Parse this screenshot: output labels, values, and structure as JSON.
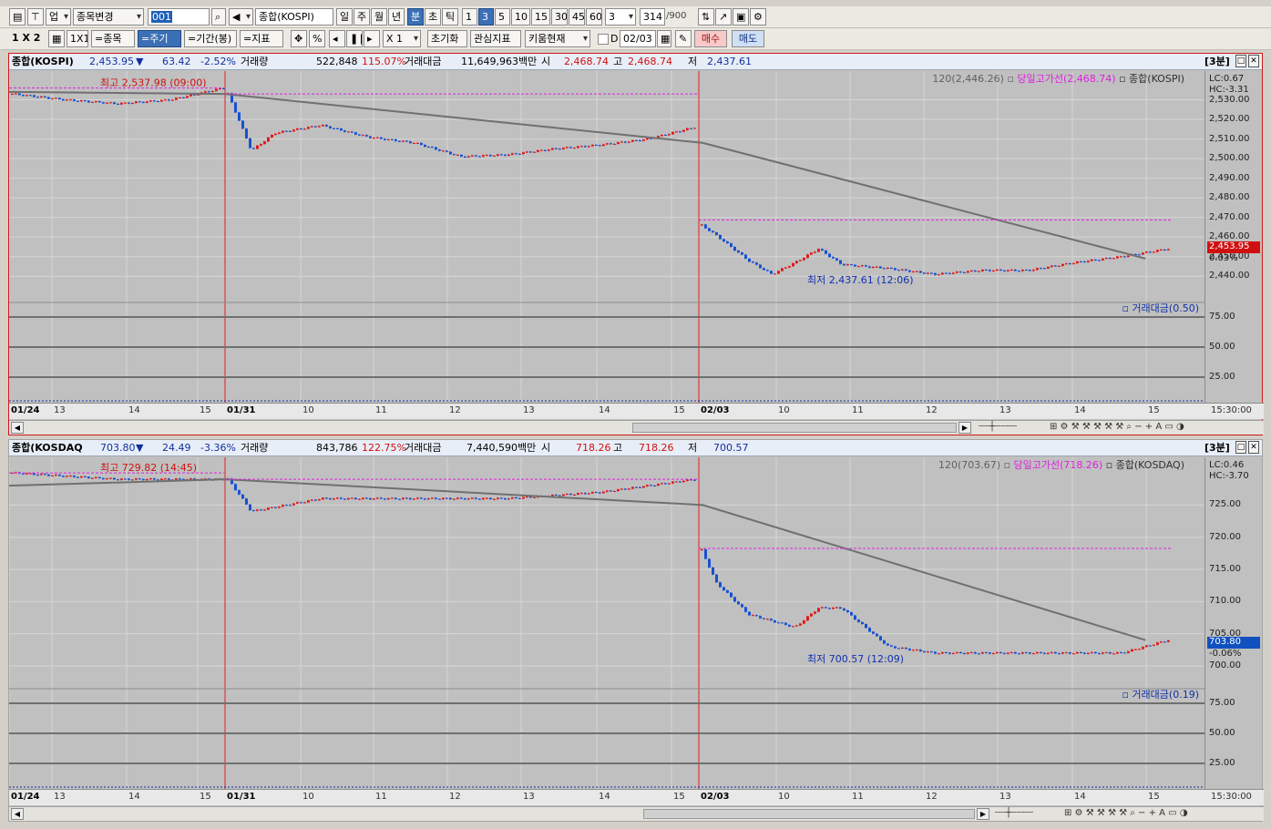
{
  "toolbar1": {
    "type_label": "업",
    "stock_change": "종목변경",
    "code": "001",
    "name": "종합(KOSPI)",
    "periods": [
      "일",
      "주",
      "월",
      "년",
      "분",
      "초",
      "틱"
    ],
    "minutes": [
      "1",
      "3",
      "5",
      "10",
      "15",
      "30",
      "45",
      "60"
    ],
    "count_select": "3",
    "count": "314",
    "count_total": "/900"
  },
  "toolbar2": {
    "layout_1x2": "1 X 2",
    "layout_1x1": "1X1",
    "btn_stock": "=종목",
    "btn_period": "=주기",
    "btn_range": "=기간(봉)",
    "btn_indicator": "=지표",
    "pct": "%",
    "zoom": "X 1",
    "reset": "초기화",
    "watch": "관심지표",
    "kiwoom": "키움현재",
    "date": "02/03",
    "buy": "매수",
    "sell": "매도"
  },
  "panel1": {
    "name": "종합(KOSPI)",
    "price": "2,453.95",
    "arrow": "▼",
    "change": "63.42",
    "rate": "-2.52%",
    "vol_label": "거래량",
    "vol": "522,848",
    "vol_rate": "115.07%",
    "amt_label": "거래대금",
    "amt": "11,649,963백만",
    "open_label": "시",
    "open": "2,468.74",
    "high_label": "고",
    "high": "2,468.74",
    "low_label": "저",
    "low": "2,437.61",
    "interval": "[3분]",
    "legend_ma": "120(2,446.26)",
    "legend_hl": "당일고가선(2,468.74)",
    "legend_name": "종합(KOSPI)",
    "lc": "LC:0.67",
    "hc": "HC:-3.31",
    "ann_high": "최고 2,537.98 (09:00)",
    "ann_low": "최저 2,437.61 (12:06)",
    "cur_tag": "2,453.95",
    "cur_pct": "0.03%",
    "y_ticks": [
      "2,530.00",
      "2,520.00",
      "2,510.00",
      "2,500.00",
      "2,490.00",
      "2,480.00",
      "2,470.00",
      "2,460.00",
      "2,450.00",
      "2,440.00"
    ],
    "sub_legend": "거래대금(0.50)",
    "sub_ticks": [
      "75.00",
      "50.00",
      "25.00"
    ],
    "time_end": "15:30:00"
  },
  "panel2": {
    "name": "종합(KOSDAQ",
    "price": "703.80",
    "arrow": "▼",
    "change": "24.49",
    "rate": "-3.36%",
    "vol_label": "거래량",
    "vol": "843,786",
    "vol_rate": "122.75%",
    "amt_label": "거래대금",
    "amt": "7,440,590백만",
    "open_label": "시",
    "open": "718.26",
    "high_label": "고",
    "high": "718.26",
    "low_label": "저",
    "low": "700.57",
    "interval": "[3분]",
    "legend_ma": "120(703.67)",
    "legend_hl": "당일고가선(718.26)",
    "legend_name": "종합(KOSDAQ)",
    "lc": "LC:0.46",
    "hc": "HC:-3.70",
    "ann_high": "최고 729.82 (14:45)",
    "ann_low": "최저 700.57 (12:09)",
    "cur_tag": "703.80",
    "cur_pct": "-0.06%",
    "y_ticks": [
      "725.00",
      "720.00",
      "715.00",
      "710.00",
      "705.00",
      "700.00"
    ],
    "sub_legend": "거래대금(0.19)",
    "sub_ticks": [
      "75.00",
      "50.00",
      "25.00"
    ],
    "time_end": "15:30:00"
  },
  "x_labels": [
    "01/24",
    "13",
    "14",
    "15",
    "01/31",
    "10",
    "11",
    "12",
    "13",
    "14",
    "15",
    "02/03",
    "10",
    "11",
    "12",
    "13",
    "14",
    "15"
  ],
  "chart_data": [
    {
      "type": "candlestick",
      "title": "종합(KOSPI)",
      "interval": "3분",
      "ylim": [
        2435,
        2540
      ],
      "sessions": [
        {
          "date": "01/24",
          "x": [
            0,
            0.25,
            0.5,
            0.75,
            1.0
          ],
          "y": [
            2533,
            2530,
            2528,
            2530,
            2536
          ]
        },
        {
          "date": "01/31",
          "x": [
            0,
            0.05,
            0.1,
            0.2,
            0.3,
            0.4,
            0.5,
            0.6,
            0.7,
            0.8,
            0.9,
            1.0
          ],
          "y": [
            2533,
            2504,
            2513,
            2517,
            2511,
            2508,
            2501,
            2502,
            2505,
            2507,
            2510,
            2516
          ]
        },
        {
          "date": "02/03",
          "x": [
            0,
            0.03,
            0.1,
            0.15,
            0.2,
            0.25,
            0.3,
            0.4,
            0.5,
            0.6,
            0.7,
            0.8,
            0.9,
            1.0
          ],
          "y": [
            2466,
            2461,
            2448,
            2441,
            2447,
            2454,
            2446,
            2444,
            2441,
            2443,
            2443,
            2447,
            2450,
            2454
          ]
        }
      ],
      "ma120": [
        {
          "x": 0,
          "y": 2534
        },
        {
          "x": 0.18,
          "y": 2533
        },
        {
          "x": 0.58,
          "y": 2508
        },
        {
          "x": 0.95,
          "y": 2449
        }
      ],
      "day_high_line": 2468.74
    },
    {
      "type": "candlestick",
      "title": "종합(KOSDAQ)",
      "interval": "3분",
      "ylim": [
        699,
        731
      ],
      "sessions": [
        {
          "date": "01/24",
          "x": [
            0,
            0.5,
            1.0
          ],
          "y": [
            730,
            729,
            729
          ]
        },
        {
          "date": "01/31",
          "x": [
            0,
            0.05,
            0.2,
            0.4,
            0.6,
            0.8,
            1.0
          ],
          "y": [
            729,
            724,
            726,
            726,
            726,
            727,
            729
          ]
        },
        {
          "date": "02/03",
          "x": [
            0,
            0.03,
            0.1,
            0.2,
            0.25,
            0.3,
            0.4,
            0.5,
            0.6,
            0.7,
            0.8,
            0.9,
            1.0
          ],
          "y": [
            718,
            713,
            708,
            706,
            709,
            709,
            703,
            702,
            702,
            702,
            702,
            702,
            704
          ]
        }
      ],
      "ma120": [
        {
          "x": 0,
          "y": 728
        },
        {
          "x": 0.18,
          "y": 729
        },
        {
          "x": 0.58,
          "y": 725
        },
        {
          "x": 0.95,
          "y": 704
        }
      ],
      "day_high_line": 718.26
    }
  ]
}
